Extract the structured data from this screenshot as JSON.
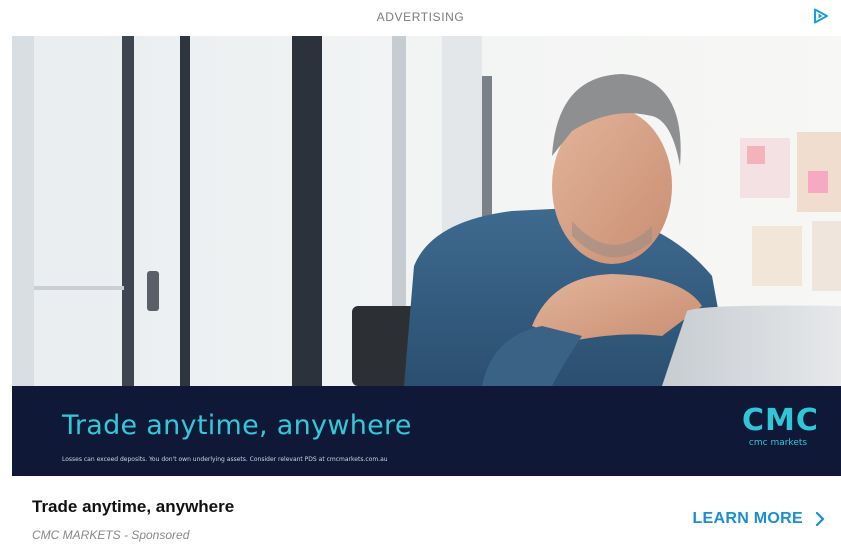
{
  "ad": {
    "label": "ADVERTISING",
    "adchoices_icon": "adchoices-triangle-icon",
    "accent_color": "#1a8ed0",
    "banner": {
      "headline": "Trade anytime, anywhere",
      "disclaimer": "Losses can exceed deposits. You don't own underlying assets. Consider relevant PDS at cmcmarkets.com.au",
      "logo_mark": "CMC",
      "logo_text": "cmc markets",
      "background_color": "#0f1937",
      "headline_color": "#31c8d8"
    },
    "title": "Trade anytime, anywhere",
    "sponsor": "CMC MARKETS - Sponsored",
    "cta_label": "LEARN MORE",
    "cta_icon": "chevron-right-icon"
  }
}
